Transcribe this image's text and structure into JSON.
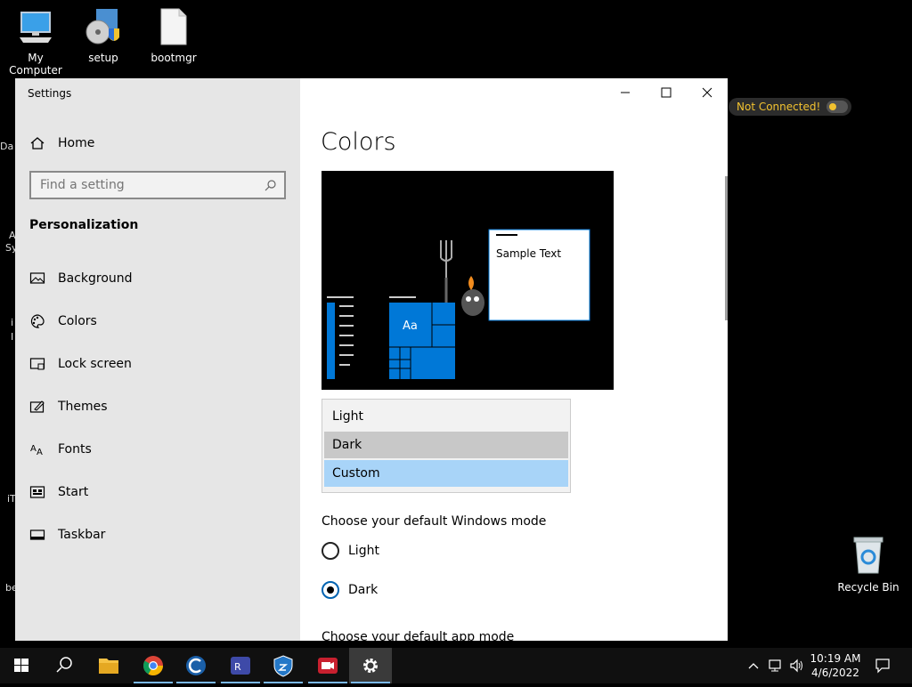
{
  "desktop": {
    "icons": [
      {
        "label": "My Computer"
      },
      {
        "label": "setup"
      },
      {
        "label": "bootmgr"
      }
    ],
    "left_edge_fragments": [
      "Da",
      "A",
      "Sy",
      "i",
      "I",
      "iT",
      "be"
    ],
    "recycle_bin": {
      "label": "Recycle Bin"
    },
    "vpn_status": {
      "label": "Not Connected!",
      "color": "#f2c230"
    }
  },
  "window": {
    "title": "Settings",
    "controls": {
      "minimize_icon": "minimize-icon",
      "maximize_icon": "maximize-icon",
      "close_icon": "close-icon"
    },
    "sidebar": {
      "home_label": "Home",
      "search_placeholder": "Find a setting",
      "section_title": "Personalization",
      "items": [
        {
          "label": "Background",
          "icon": "picture-icon"
        },
        {
          "label": "Colors",
          "icon": "palette-icon"
        },
        {
          "label": "Lock screen",
          "icon": "lock-screen-icon"
        },
        {
          "label": "Themes",
          "icon": "themes-icon"
        },
        {
          "label": "Fonts",
          "icon": "fonts-icon"
        },
        {
          "label": "Start",
          "icon": "start-icon"
        },
        {
          "label": "Taskbar",
          "icon": "taskbar-icon"
        }
      ]
    },
    "content": {
      "page_title": "Colors",
      "preview": {
        "sample_text": "Sample Text",
        "tile_text": "Aa",
        "accent_color": "#0078d7"
      },
      "color_dropdown": {
        "options": [
          {
            "label": "Light",
            "state": "normal"
          },
          {
            "label": "Dark",
            "state": "hover"
          },
          {
            "label": "Custom",
            "state": "selected"
          }
        ]
      },
      "windows_mode": {
        "label": "Choose your default Windows mode",
        "options": [
          {
            "label": "Light",
            "selected": false
          },
          {
            "label": "Dark",
            "selected": true
          }
        ]
      },
      "app_mode_label": "Choose your default app mode"
    }
  },
  "taskbar": {
    "apps": [
      "start-icon",
      "search-icon",
      "file-explorer-icon",
      "chrome-icon",
      "ccleaner-icon",
      "remote-app-icon",
      "vpn-shield-icon",
      "screen-recorder-icon",
      "settings-icon"
    ],
    "clock": {
      "time": "10:19 AM",
      "date": "4/6/2022"
    }
  }
}
